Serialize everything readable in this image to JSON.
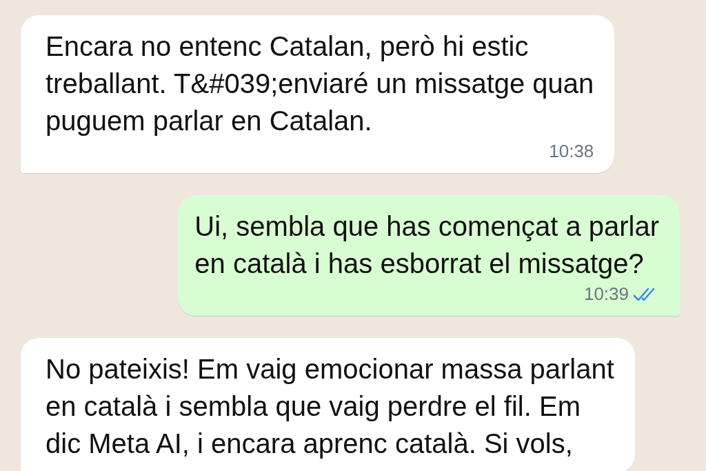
{
  "messages": [
    {
      "kind": "incoming",
      "text": "Encara no entenc Catalan, però hi estic\ntreballant. T&#039;enviaré un missatge quan\npuguem parlar en Catalan.",
      "time": "10:38"
    },
    {
      "kind": "outgoing",
      "text": "Ui, sembla que has començat a parlar\nen català i has esborrat el missatge?",
      "time": "10:39",
      "read": true
    },
    {
      "kind": "incoming",
      "text": "No pateixis! Em vaig emocionar massa parlant\nen català i sembla que vaig perdre el fil. Em\ndic Meta AI, i encara aprenc català. Si vols,"
    }
  ]
}
